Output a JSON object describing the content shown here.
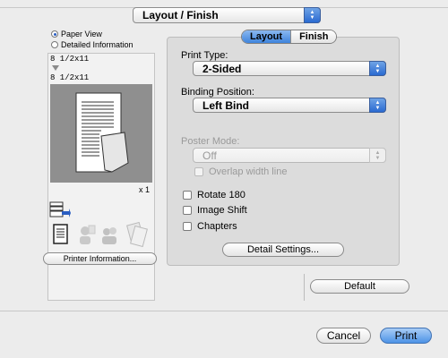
{
  "header": {
    "panel_select": "Layout / Finish"
  },
  "preview": {
    "view_options": [
      {
        "label": "Paper View",
        "selected": true
      },
      {
        "label": "Detailed Information",
        "selected": false
      }
    ],
    "paper_in": "8 1/2x11",
    "paper_out": "8 1/2x11",
    "copies": "x 1",
    "printer_info_button": "Printer Information..."
  },
  "tabs": [
    {
      "label": "Layout",
      "active": true
    },
    {
      "label": "Finish",
      "active": false
    }
  ],
  "form": {
    "print_type_label": "Print Type:",
    "print_type_value": "2-Sided",
    "binding_label": "Binding Position:",
    "binding_value": "Left Bind",
    "poster_label": "Poster Mode:",
    "poster_value": "Off",
    "overlap_label": "Overlap width line",
    "rotate_label": "Rotate 180",
    "image_shift_label": "Image Shift",
    "chapters_label": "Chapters",
    "detail_button": "Detail Settings..."
  },
  "footer": {
    "default_button": "Default",
    "cancel_button": "Cancel",
    "print_button": "Print"
  },
  "colors": {
    "accent": "#3f84dd",
    "panel": "#dcdcdc"
  }
}
